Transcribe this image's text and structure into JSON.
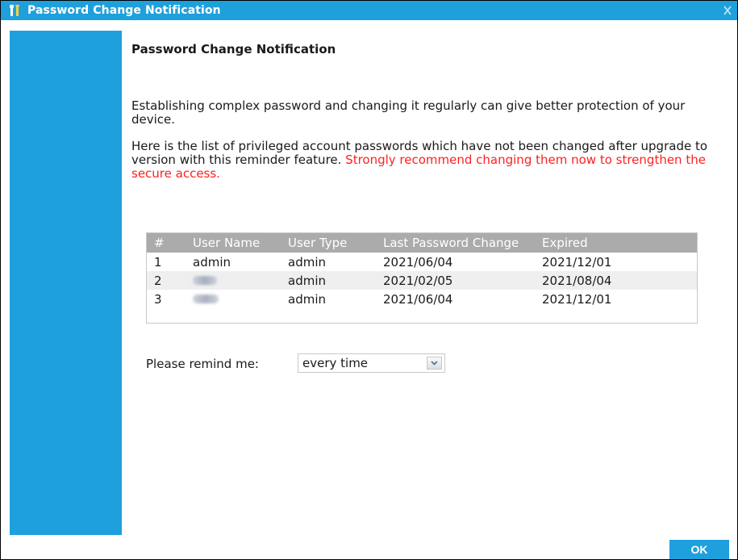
{
  "window": {
    "title": "Password Change Notification"
  },
  "main": {
    "heading": "Password Change Notification",
    "paragraph1": "Establishing complex password and changing it regularly can give better protection of your device.",
    "paragraph2_normal": "Here is the list of privileged account passwords which have not been changed after upgrade to version with this reminder feature. ",
    "paragraph2_warning": "Strongly recommend changing them now to strengthen the secure access."
  },
  "table": {
    "headers": [
      "#",
      "User Name",
      "User Type",
      "Last Password Change",
      "Expired"
    ],
    "rows": [
      {
        "index": "1",
        "user_name": "admin",
        "user_type": "admin",
        "last_change": "2021/06/04",
        "expired": "2021/12/01"
      },
      {
        "index": "2",
        "user_name": "",
        "user_type": "admin",
        "last_change": "2021/02/05",
        "expired": "2021/08/04"
      },
      {
        "index": "3",
        "user_name": "",
        "user_type": "admin",
        "last_change": "2021/06/04",
        "expired": "2021/12/01"
      }
    ]
  },
  "remind": {
    "label": "Please remind me:",
    "selected": "every time"
  },
  "footer": {
    "ok_label": "OK"
  },
  "colors": {
    "accent": "#1ea0dd",
    "warning": "#ff1f1f",
    "table_header": "#ababab"
  },
  "icons": {
    "title": "tools-icon",
    "close": "close-icon",
    "dropdown": "chevron-down-icon"
  }
}
